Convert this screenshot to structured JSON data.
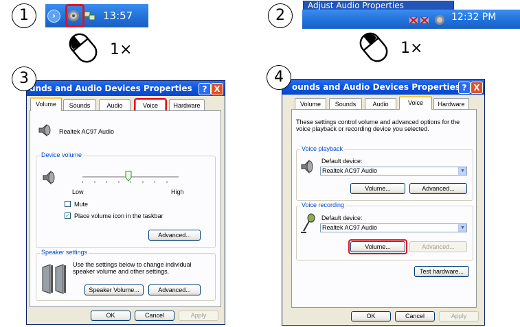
{
  "steps": {
    "s1": "1",
    "s2": "2",
    "s3": "3",
    "s4": "4"
  },
  "panel1": {
    "time": "13:57",
    "click_count": "1×"
  },
  "panel2": {
    "menu_item": "Adjust Audio Properties",
    "time": "12:32 PM",
    "click_count": "1×"
  },
  "dialog3": {
    "title": "unds and Audio Devices Properties",
    "help": "?",
    "close": "X",
    "tabs": [
      "Volume",
      "Sounds",
      "Audio",
      "Voice",
      "Hardware"
    ],
    "device_name": "Realtek AC97 Audio",
    "device_volume_legend": "Device volume",
    "low": "Low",
    "high": "High",
    "mute": "Mute",
    "place_icon": "Place volume icon in the taskbar",
    "advanced1": "Advanced...",
    "speaker_legend": "Speaker settings",
    "speaker_desc": "Use the settings below to change individual speaker volume and other settings.",
    "speaker_volume": "Speaker Volume...",
    "advanced2": "Advanced...",
    "ok": "OK",
    "cancel": "Cancel",
    "apply": "Apply",
    "volume_level": 0.48
  },
  "dialog4": {
    "title": "ounds and Audio Devices Properties",
    "help": "?",
    "close": "X",
    "tabs": [
      "Volume",
      "Sounds",
      "Audio",
      "Voice",
      "Hardware"
    ],
    "intro": "These settings control volume and advanced options for the voice playback or recording device you selected.",
    "playback_legend": "Voice playback",
    "default_device": "Default device:",
    "playback_device": "Realtek AC97 Audio",
    "volume_btn": "Volume...",
    "advanced_btn": "Advanced...",
    "recording_legend": "Voice recording",
    "default_device2": "Default device:",
    "recording_device": "Realtek AC97 Audio",
    "volume_btn2": "Volume...",
    "advanced_btn2": "Advanced...",
    "test_hardware": "Test hardware...",
    "ok": "OK",
    "cancel": "Cancel",
    "apply": "Apply"
  },
  "colors": {
    "highlight": "#e0141e",
    "taskbar": "#1f6fd8",
    "titlebar": "#0a54e3"
  }
}
